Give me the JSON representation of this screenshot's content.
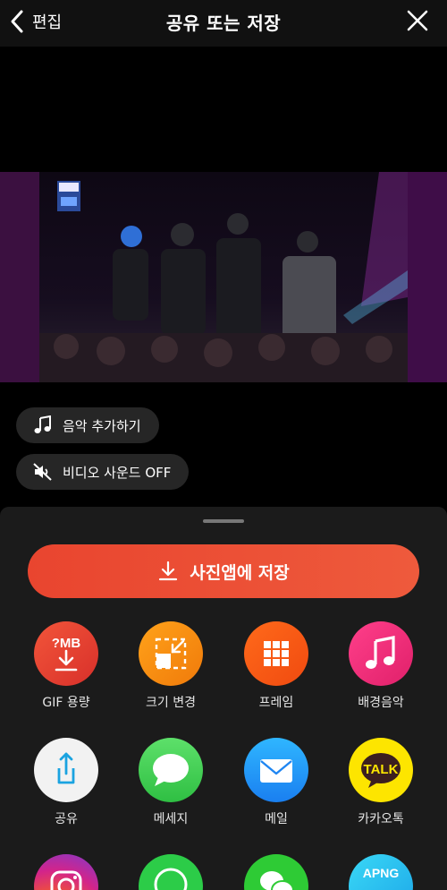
{
  "header": {
    "back_label": "편집",
    "title": "공유 또는 저장"
  },
  "preview": {
    "music_button_label": "음악 추가하기",
    "sound_button_label": "비디오 사운드 OFF"
  },
  "sheet": {
    "save_label": "사진앱에 저장",
    "items": [
      {
        "label": "GIF 용량",
        "icon": "gif-size-icon",
        "badge": "?MB"
      },
      {
        "label": "크기 변경",
        "icon": "resize-icon"
      },
      {
        "label": "프레임",
        "icon": "frame-grid-icon"
      },
      {
        "label": "배경음악",
        "icon": "music-note-icon"
      },
      {
        "label": "공유",
        "icon": "share-icon"
      },
      {
        "label": "메세지",
        "icon": "message-bubble-icon"
      },
      {
        "label": "메일",
        "icon": "mail-icon"
      },
      {
        "label": "카카오톡",
        "icon": "kakaotalk-icon",
        "badge": "TALK"
      },
      {
        "label": "",
        "icon": "instagram-icon"
      },
      {
        "label": "",
        "icon": "whatsapp-icon"
      },
      {
        "label": "",
        "icon": "wechat-icon"
      },
      {
        "label": "",
        "icon": "apng-icon",
        "badge": "APNG"
      }
    ]
  },
  "colors": {
    "accent": "#ec4f35",
    "sheet_bg": "#1b1b1b",
    "pill_bg": "#262626"
  }
}
